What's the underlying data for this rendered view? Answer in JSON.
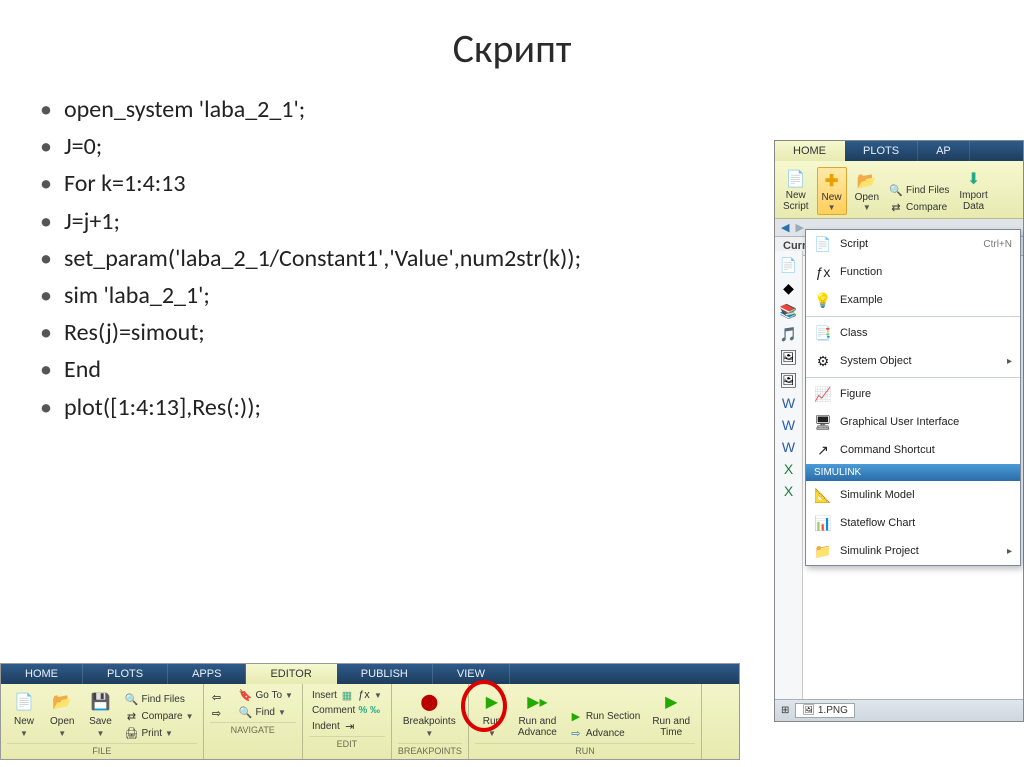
{
  "title": "Скрипт",
  "code": [
    "open_system 'laba_2_1';",
    "J=0;",
    "For k=1:4:13",
    "J=j+1;",
    "set_param('laba_2_1/Constant1','Value',num2str(k));",
    "sim 'laba_2_1';",
    "Res(j)=simout;",
    "End",
    "plot([1:4:13],Res(:));"
  ],
  "bottom": {
    "tabs": [
      "HOME",
      "PLOTS",
      "APPS",
      "EDITOR",
      "PUBLISH",
      "VIEW"
    ],
    "activeTab": "EDITOR",
    "groups": {
      "file_label": "FILE",
      "new": "New",
      "open": "Open",
      "save": "Save",
      "findfiles": "Find Files",
      "compare": "Compare",
      "print": "Print",
      "nav_label": "NAVIGATE",
      "goto": "Go To",
      "find": "Find",
      "edit_label": "EDIT",
      "insert": "Insert",
      "comment": "Comment",
      "indent": "Indent",
      "bp_label": "BREAKPOINTS",
      "breakpoints": "Breakpoints",
      "run_label": "RUN",
      "run": "Run",
      "runadvance": "Run and\nAdvance",
      "runsection": "Run Section",
      "advance": "Advance",
      "runtime": "Run and\nTime"
    }
  },
  "right": {
    "tabs": [
      "HOME",
      "PLOTS",
      "AP"
    ],
    "activeTab": "HOME",
    "newscript": "New\nScript",
    "new": "New",
    "open": "Open",
    "findfiles": "Find Files",
    "compare": "Compare",
    "import": "Import\nData",
    "current": "Curren",
    "dropdown": [
      {
        "icon": "📄",
        "label": "Script",
        "shortcut": "Ctrl+N"
      },
      {
        "icon": "ƒx",
        "label": "Function"
      },
      {
        "icon": "💡",
        "label": "Example"
      },
      {
        "icon": "📑",
        "label": "Class"
      },
      {
        "icon": "⚙",
        "label": "System Object",
        "submenu": true
      },
      {
        "icon": "📈",
        "label": "Figure"
      },
      {
        "icon": "🖥",
        "label": "Graphical User Interface"
      },
      {
        "icon": "↗",
        "label": "Command Shortcut"
      }
    ],
    "simulink_header": "SIMULINK",
    "simulink_items": [
      {
        "icon": "📐",
        "label": "Simulink Model"
      },
      {
        "icon": "📊",
        "label": "Stateflow Chart"
      },
      {
        "icon": "📁",
        "label": "Simulink Project",
        "submenu": true
      }
    ],
    "taskbar": "1.PNG"
  }
}
